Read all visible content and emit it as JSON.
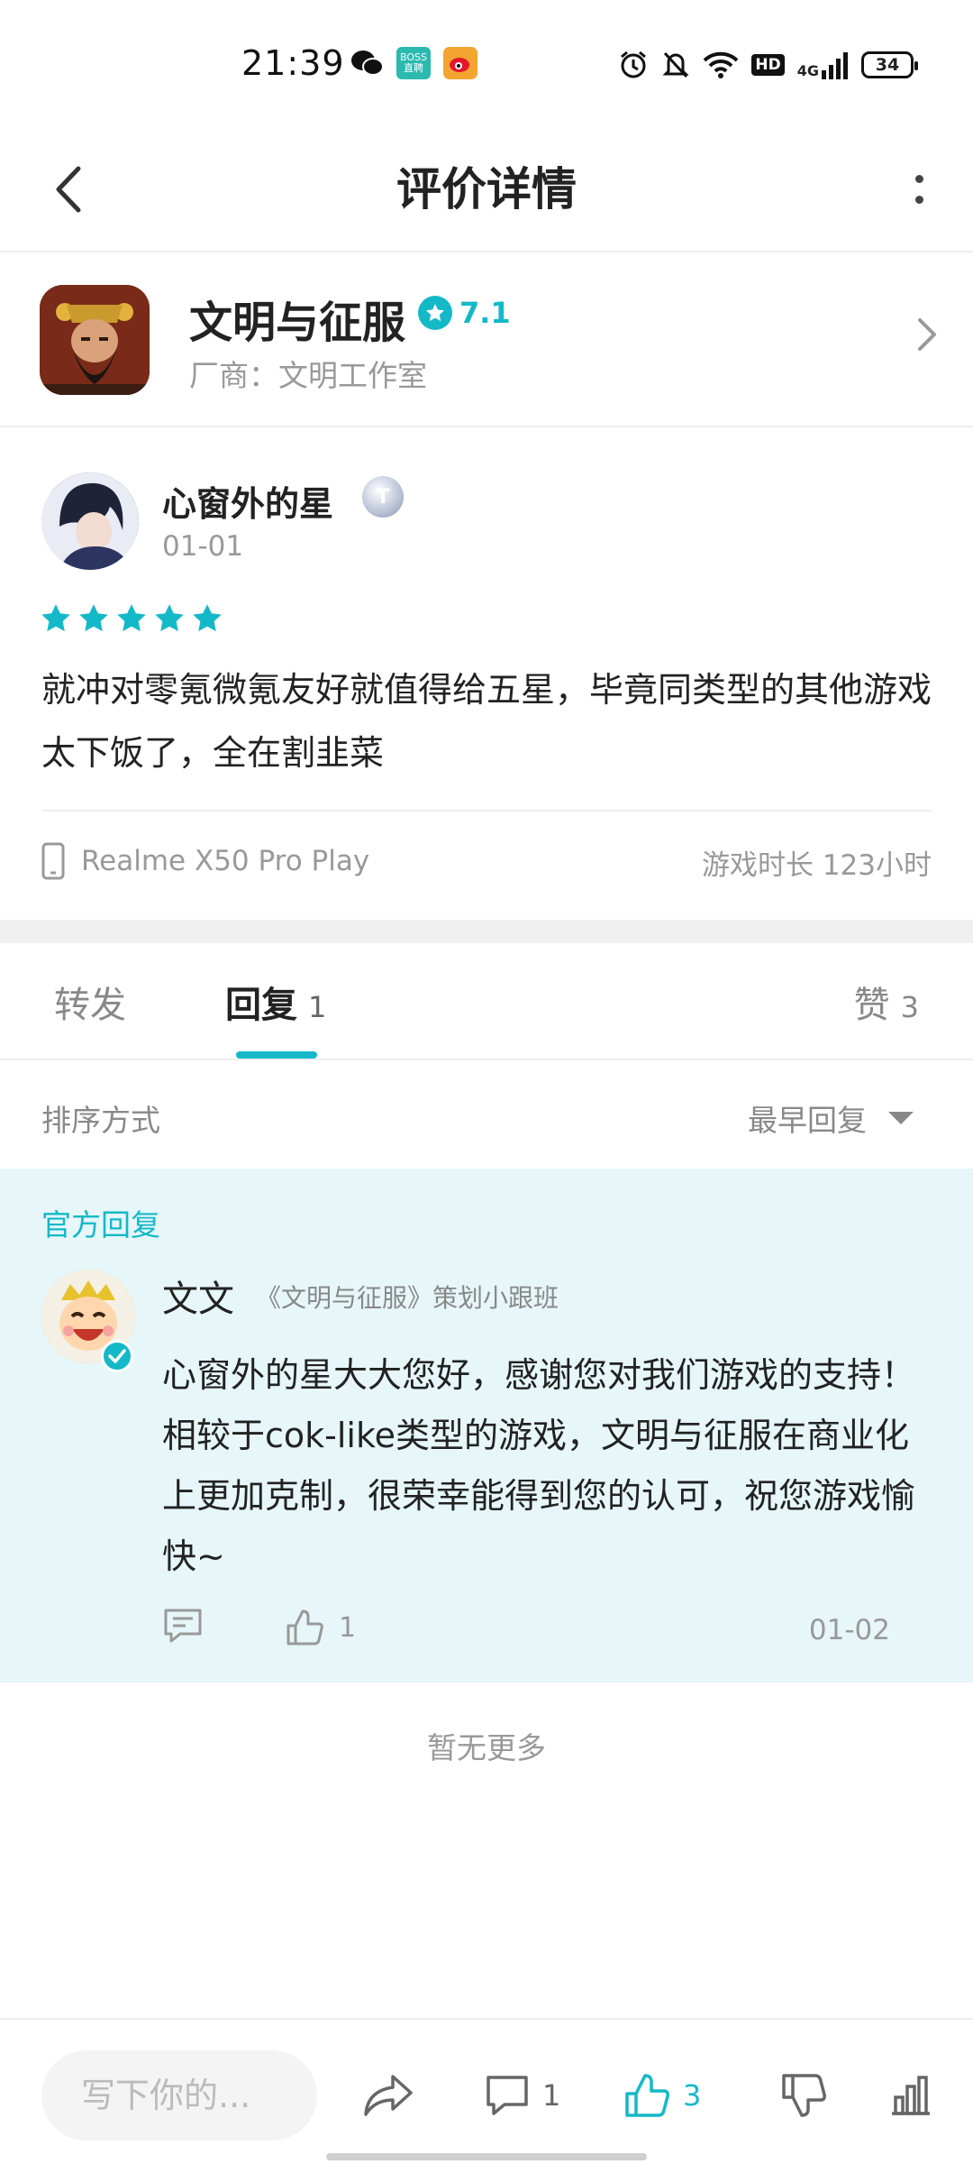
{
  "status_bar": {
    "time": "21:39",
    "notification_icons": [
      "wechat-icon",
      "boss-zhipin-icon",
      "weibo-icon"
    ],
    "boss_label_top": "BOSS",
    "boss_label_bottom": "直聘",
    "system_icons": [
      "alarm-icon",
      "mute-icon",
      "wifi-icon",
      "hd-icon",
      "signal-4g-icon",
      "battery-icon"
    ],
    "hd_label": "HD",
    "network": "4G",
    "battery": "34"
  },
  "header": {
    "title": "评价详情"
  },
  "game": {
    "name": "文明与征服",
    "rating": "7.1",
    "vendor": "厂商：文明工作室"
  },
  "review": {
    "author": "心窗外的星",
    "level_badge": "T",
    "date": "01-01",
    "stars": 5,
    "text": "就冲对零氪微氪友好就值得给五星，毕竟同类型的其他游戏太下饭了，全在割韭菜",
    "device": "Realme X50 Pro Play",
    "playtime": "游戏时长 123小时"
  },
  "tabs": {
    "forward": {
      "label": "转发"
    },
    "reply": {
      "label": "回复",
      "count": "1"
    },
    "like": {
      "label": "赞",
      "count": "3"
    }
  },
  "sort": {
    "label": "排序方式",
    "selected": "最早回复"
  },
  "official_reply": {
    "section_label": "官方回复",
    "author": "文文",
    "role": "《文明与征服》策划小跟班",
    "text": "心窗外的星大大您好，感谢您对我们游戏的支持！相较于cok-like类型的游戏，文明与征服在商业化上更加克制，很荣幸能得到您的认可，祝您游戏愉快~",
    "like_count": "1",
    "date": "01-02"
  },
  "footer": {
    "no_more": "暂无更多"
  },
  "bottom_bar": {
    "input_placeholder": "写下你的...",
    "comment_count": "1",
    "like_count": "3"
  },
  "colors": {
    "accent": "#14b9c8",
    "official_bg": "#e6f6f9",
    "muted_text": "#999999"
  }
}
